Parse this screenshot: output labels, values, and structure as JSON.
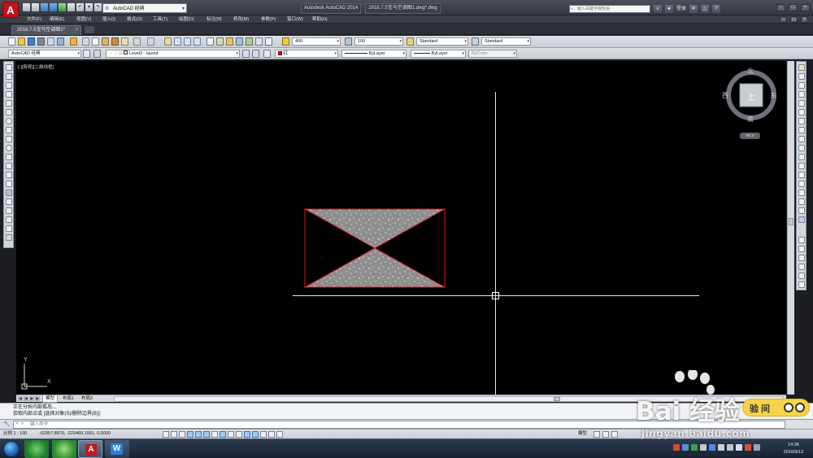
{
  "titlebar": {
    "logo": "A",
    "workspace": "AutoCAD 经典",
    "app_name": "Autodesk AutoCAD 2014",
    "file_title": "2016.7.5宝马空调图1.dwg*.dwg",
    "search_placeholder": "键入关键字或短语",
    "login": "登录"
  },
  "menu": [
    "文件(F)",
    "编辑(E)",
    "视图(V)",
    "插入(I)",
    "格式(O)",
    "工具(T)",
    "绘图(D)",
    "标注(N)",
    "修改(M)",
    "参数(P)",
    "窗口(W)",
    "帮助(H)"
  ],
  "doc_tab": {
    "label": "2016.7.5宝马空调图1*",
    "close": "×"
  },
  "toolbar1": {
    "textstyle_height": "400",
    "dimscale": "100",
    "textstyle": "Standard",
    "dimstyle": "Standard"
  },
  "toolbar2": {
    "workspace": "AutoCAD 经典",
    "layer": "Level3 - layout",
    "color": "红",
    "linetype": "ByLayer",
    "lineweight": "ByLayer",
    "plotstyle": "ByColor"
  },
  "viewport_label": "[-][俯视][二维线框]",
  "viewcube": {
    "north": "北",
    "south": "南",
    "east": "东",
    "west": "西",
    "face": "上",
    "wcs": "WCS"
  },
  "ucs": {
    "y": "Y",
    "x": "X"
  },
  "layout_tabs": {
    "model": "模型",
    "layout1": "布局1",
    "layout2": "布局2"
  },
  "command": {
    "history": [
      "正在分析内部孤岛...",
      "拾取内部点或 [选择对象(S)/删除边界(B)]:"
    ],
    "placeholder": "键入命令"
  },
  "status": {
    "scale": "比例 1 : 100",
    "coords": "-62957.8870,  -223469.1991,  0.0000",
    "model": "模型"
  },
  "clock": {
    "time": "14:36",
    "date": "2016/9/13"
  },
  "watermark": {
    "logo": "Bai 经验",
    "url": "jingyan.baidu.com",
    "badge": "验 间"
  },
  "colors": {
    "drawing_red": "#d11a22",
    "hatch_gray": "#9a9a9a",
    "canvas_bg": "#000000",
    "crosshair": "#ffffff",
    "layer_red": "#e01010"
  }
}
